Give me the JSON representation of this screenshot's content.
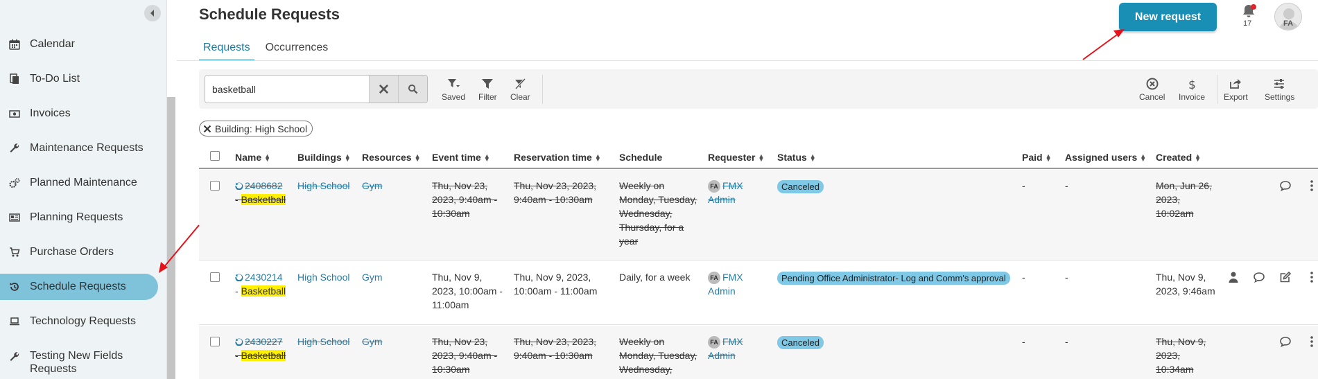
{
  "sidebar": {
    "items": [
      {
        "label": "Calendar",
        "icon": "calendar-icon"
      },
      {
        "label": "To-Do List",
        "icon": "todo-icon"
      },
      {
        "label": "Invoices",
        "icon": "invoice-icon"
      },
      {
        "label": "Maintenance Requests",
        "icon": "wrench-icon"
      },
      {
        "label": "Planned Maintenance",
        "icon": "gears-icon"
      },
      {
        "label": "Planning Requests",
        "icon": "newspaper-icon"
      },
      {
        "label": "Purchase Orders",
        "icon": "cart-icon"
      },
      {
        "label": "Schedule Requests",
        "icon": "history-icon",
        "active": true
      },
      {
        "label": "Technology Requests",
        "icon": "laptop-icon"
      },
      {
        "label": "Testing New Fields Requests",
        "icon": "wrench-icon"
      }
    ]
  },
  "header": {
    "title": "Schedule Requests",
    "new_request_label": "New request",
    "notification_count": "17",
    "avatar_initials": "FA"
  },
  "tabs": [
    {
      "label": "Requests",
      "active": true
    },
    {
      "label": "Occurrences",
      "active": false
    }
  ],
  "toolbar": {
    "search_value": "basketball",
    "saved_label": "Saved",
    "filter_label": "Filter",
    "clear_label": "Clear",
    "cancel_label": "Cancel",
    "invoice_label": "Invoice",
    "export_label": "Export",
    "settings_label": "Settings"
  },
  "filter_chip": {
    "label": "Building: High School"
  },
  "table": {
    "columns": {
      "name": "Name",
      "buildings": "Buildings",
      "resources": "Resources",
      "event_time": "Event time",
      "reservation_time": "Reservation time",
      "schedule": "Schedule",
      "requester": "Requester",
      "status": "Status",
      "paid": "Paid",
      "assigned_users": "Assigned users",
      "created": "Created"
    },
    "rows": [
      {
        "id": "2408682",
        "name_sep": "- ",
        "name_highlight": "Basketball",
        "building": "High School",
        "resource": "Gym",
        "event_time": "Thu, Nov 23, 2023, 9:40am - 10:30am",
        "reservation_time": "Thu, Nov 23, 2023, 9:40am - 10:30am",
        "schedule": "Weekly on Monday, Tuesday, Wednesday, Thursday, for a year",
        "requester_initials": "FA",
        "requester_name": "FMX Admin",
        "status": "Canceled",
        "paid": "-",
        "assigned": "-",
        "created": "Mon, Jun 26, 2023, 10:02am",
        "canceled": true
      },
      {
        "id": "2430214",
        "name_sep": "- ",
        "name_highlight": "Basketball",
        "building": "High School",
        "resource": "Gym",
        "event_time": "Thu, Nov 9, 2023, 10:00am - 11:00am",
        "reservation_time": "Thu, Nov 9, 2023, 10:00am - 11:00am",
        "schedule": "Daily, for a week",
        "requester_initials": "FA",
        "requester_name": "FMX Admin",
        "status": "Pending Office Administrator- Log and Comm's approval",
        "paid": "-",
        "assigned": "-",
        "created": "Thu, Nov 9, 2023, 9:46am",
        "canceled": false
      },
      {
        "id": "2430227",
        "name_sep": "- ",
        "name_highlight": "Basketball",
        "building": "High School",
        "resource": "Gym",
        "event_time": "Thu, Nov 23, 2023, 9:40am - 10:30am",
        "reservation_time": "Thu, Nov 23, 2023, 9:40am - 10:30am",
        "schedule": "Weekly on Monday, Tuesday, Wednesday,",
        "requester_initials": "FA",
        "requester_name": "FMX Admin",
        "status": "Canceled",
        "paid": "-",
        "assigned": "-",
        "created": "Thu, Nov 9, 2023, 10:34am",
        "canceled": true
      }
    ]
  },
  "colors": {
    "accent": "#1a8fb5",
    "active_nav": "#7fc3db",
    "status_badge": "#7fc8e6",
    "highlight": "#ffef00",
    "annotation_arrow": "#e3121b"
  }
}
